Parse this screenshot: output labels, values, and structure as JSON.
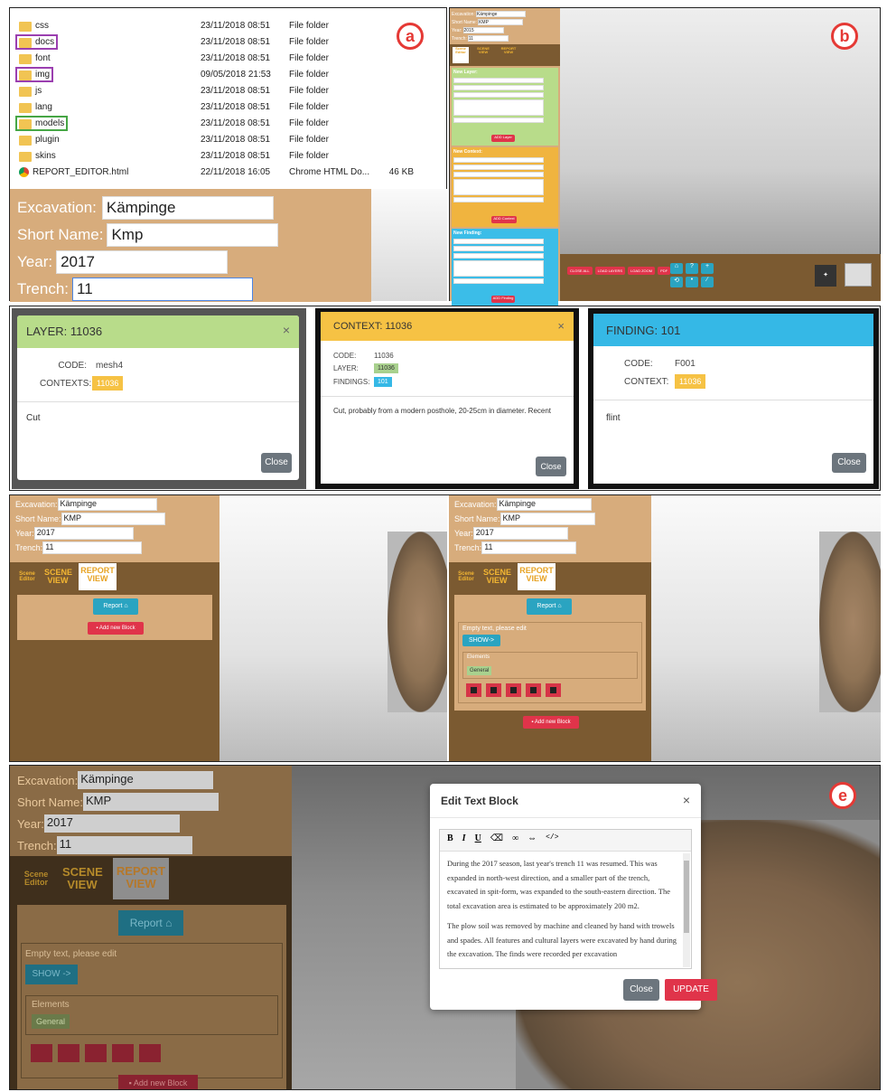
{
  "panel_a": {
    "badge": "a",
    "files": [
      {
        "name": "css",
        "date": "23/11/2018 08:51",
        "type": "File folder",
        "size": "",
        "hl": ""
      },
      {
        "name": "docs",
        "date": "23/11/2018 08:51",
        "type": "File folder",
        "size": "",
        "hl": "purple"
      },
      {
        "name": "font",
        "date": "23/11/2018 08:51",
        "type": "File folder",
        "size": "",
        "hl": ""
      },
      {
        "name": "img",
        "date": "09/05/2018 21:53",
        "type": "File folder",
        "size": "",
        "hl": "purple"
      },
      {
        "name": "js",
        "date": "23/11/2018 08:51",
        "type": "File folder",
        "size": "",
        "hl": ""
      },
      {
        "name": "lang",
        "date": "23/11/2018 08:51",
        "type": "File folder",
        "size": "",
        "hl": ""
      },
      {
        "name": "models",
        "date": "23/11/2018 08:51",
        "type": "File folder",
        "size": "",
        "hl": "green"
      },
      {
        "name": "plugin",
        "date": "23/11/2018 08:51",
        "type": "File folder",
        "size": "",
        "hl": ""
      },
      {
        "name": "skins",
        "date": "23/11/2018 08:51",
        "type": "File folder",
        "size": "",
        "hl": ""
      },
      {
        "name": "REPORT_EDITOR.html",
        "date": "22/11/2018 16:05",
        "type": "Chrome HTML Do...",
        "size": "46 KB",
        "hl": ""
      }
    ],
    "form": {
      "excavation_label": "Excavation:",
      "excavation_value": "Kämpinge",
      "short_label": "Short Name:",
      "short_value": "Kmp",
      "year_label": "Year:",
      "year_value": "2017",
      "trench_label": "Trench:",
      "trench_value": "11"
    }
  },
  "panel_b": {
    "badge": "b",
    "form": {
      "excavation_label": "Excavation:",
      "excavation_value": "Kämpinge",
      "short_label": "Short Name:",
      "short_value": "KMP",
      "year_label": "Year:",
      "year_value": "2015",
      "trench_label": "Trench:",
      "trench_value": "11"
    },
    "tabs": [
      "Scene Editor",
      "SCENE VIEW",
      "REPORT VIEW"
    ],
    "new_layer_title": "New Layer:",
    "new_context_title": "New Context:",
    "new_finding_title": "New Finding:",
    "add_layer": "ADD Layer",
    "add_context": "ADD Context",
    "add_finding": "ADD Finding",
    "bottom_buttons": [
      "CLOSE ALL",
      "LOAD LAYERS",
      "LOAD ZOOM",
      "PDF"
    ]
  },
  "panel_c": {
    "badge": "c",
    "layer": {
      "title": "LAYER: 11036",
      "code_label": "CODE:",
      "code_value": "mesh4",
      "contexts_label": "CONTEXTS:",
      "contexts_value": "11036",
      "body": "Cut",
      "close": "Close",
      "x": "×"
    },
    "context": {
      "title": "CONTEXT: 11036",
      "code_label": "CODE:",
      "code_value": "11036",
      "layer_label": "LAYER:",
      "layer_value": "11036",
      "findings_label": "FINDINGS:",
      "findings_value": "101",
      "body": "Cut, probably from a modern posthole, 20-25cm in diameter. Recent",
      "close": "Close",
      "x": "×"
    },
    "finding": {
      "title": "FINDING: 101",
      "code_label": "CODE:",
      "code_value": "F001",
      "context_label": "CONTEXT:",
      "context_value": "11036",
      "body": "flint",
      "close": "Close"
    }
  },
  "panel_d": {
    "badge": "d",
    "form_left": {
      "excavation_label": "Excavation:",
      "excavation_value": "Kämpinge",
      "short_label": "Short Name:",
      "short_value": "KMP",
      "year_label": "Year:",
      "year_value": "2017",
      "trench_label": "Trench:",
      "trench_value": "11"
    },
    "tabs": {
      "scene_editor": "Scene Editor",
      "scene_view": "SCENE VIEW",
      "report_view": "REPORT VIEW"
    },
    "report_btn": "Report",
    "add_block": "Add new Block",
    "empty_text": "Empty text, please edit",
    "show_btn": "SHOW->",
    "elements_label": "Elements",
    "general": "General"
  },
  "panel_e": {
    "badge": "e",
    "form": {
      "excavation_label": "Excavation:",
      "excavation_value": "Kämpinge",
      "short_label": "Short Name:",
      "short_value": "KMP",
      "year_label": "Year:",
      "year_value": "2017",
      "trench_label": "Trench:",
      "trench_value": "11"
    },
    "tabs": {
      "scene_editor": "Scene Editor",
      "scene_view": "SCENE VIEW",
      "report_view": "REPORT VIEW"
    },
    "report_btn": "Report",
    "empty_text": "Empty text, please edit",
    "show_btn": "SHOW ->",
    "elements_label": "Elements",
    "general": "General",
    "add_block": "Add new Block",
    "modal": {
      "title": "Edit Text Block",
      "x": "×",
      "toolbar": [
        "B",
        "I",
        "U",
        "⌫",
        "∞",
        "⇔",
        "</>"
      ],
      "para1": "During the 2017 season, last year's trench 11 was resumed. This was expanded in north-west direction, and a smaller part of the trench, excavated in spit-form, was expanded to the south-eastern direction. The total excavation area is estimated to be approximately 200 m2.",
      "para2": "The plow soil was removed by machine and cleaned by hand with trowels and spades. All features and cultural layers were excavated by hand during the excavation. The finds were recorded per excavation",
      "close": "Close",
      "update": "UPDATE"
    }
  },
  "colors": {
    "tan": "#d7ac7c",
    "dark_brown": "#7b5a31",
    "red": "#e0344a",
    "teal": "#2aa4c1",
    "green": "#a9d18e",
    "orange": "#f6c244",
    "blue": "#35b8e6",
    "badge_red": "#e53935"
  }
}
